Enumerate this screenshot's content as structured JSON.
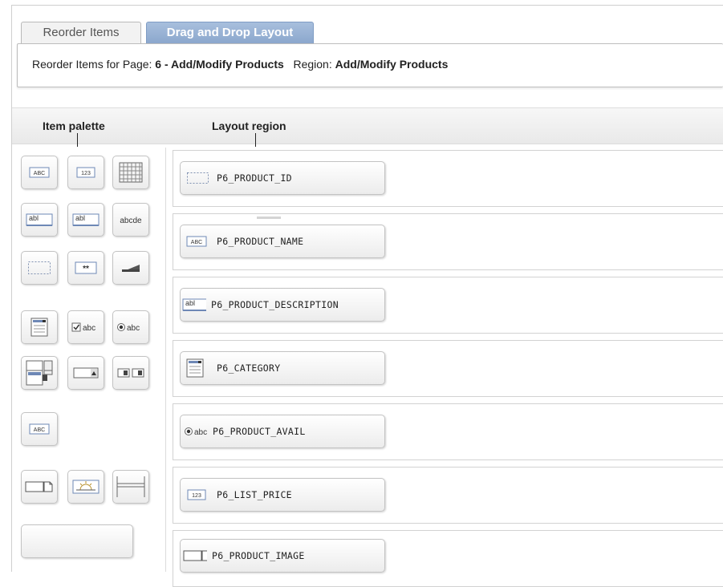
{
  "tabs": [
    {
      "label": "Reorder Items",
      "active": false
    },
    {
      "label": "Drag and Drop Layout",
      "active": true
    }
  ],
  "header": {
    "prefix": "Reorder Items for Page: ",
    "page": "6 - Add/Modify Products",
    "region_prefix": "Region: ",
    "region": "Add/Modify Products"
  },
  "columns": {
    "palette": "Item palette",
    "layout": "Layout region"
  },
  "palette": [
    {
      "icon": "abc-text-icon",
      "text": "ABC"
    },
    {
      "icon": "number-field-icon",
      "text": "123"
    },
    {
      "icon": "grid-icon"
    },
    {
      "icon": "text-field-icon",
      "text": "abl"
    },
    {
      "icon": "text-field-icon",
      "text": "abl"
    },
    {
      "icon": "text-area-icon",
      "text": "abcde"
    },
    {
      "icon": "hidden-item-icon"
    },
    {
      "icon": "password-icon",
      "text": "**"
    },
    {
      "icon": "button-icon"
    },
    {
      "icon": "select-list-icon"
    },
    {
      "icon": "checkbox-icon",
      "text": "abc"
    },
    {
      "icon": "radio-icon",
      "text": "abc"
    },
    {
      "icon": "popup-lov-icon"
    },
    {
      "icon": "combobox-icon"
    },
    {
      "icon": "shuttle-icon"
    },
    {
      "icon": "display-only-icon",
      "text": "ABC"
    },
    {
      "icon": "file-browse-icon"
    },
    {
      "icon": "date-picker-icon"
    },
    {
      "icon": "stop-start-icon"
    },
    {
      "icon": "empty-item-icon"
    }
  ],
  "layout_items": [
    {
      "icon": "hidden-item-icon",
      "label": "P6_PRODUCT_ID"
    },
    {
      "icon": "display-only-icon",
      "icon_text": "ABC",
      "label": "P6_PRODUCT_NAME"
    },
    {
      "icon": "text-field-icon",
      "icon_text": "abl",
      "label": "P6_PRODUCT_DESCRIPTION"
    },
    {
      "icon": "select-list-icon",
      "label": "P6_CATEGORY"
    },
    {
      "icon": "radio-icon",
      "icon_text": "abc",
      "label": "P6_PRODUCT_AVAIL"
    },
    {
      "icon": "number-field-icon",
      "icon_text": "123",
      "label": "P6_LIST_PRICE"
    },
    {
      "icon": "file-browse-icon",
      "label": "P6_PRODUCT_IMAGE"
    }
  ],
  "colors": {
    "active_tab": "#8aa6cc",
    "icon_blue": "#6e88b6",
    "panel_border": "#c3c3c3"
  }
}
